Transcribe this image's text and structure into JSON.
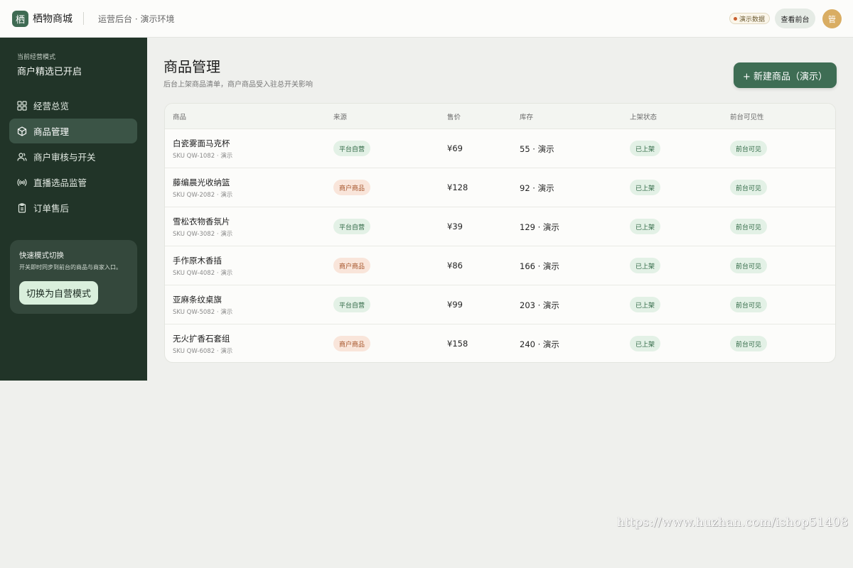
{
  "header": {
    "logo_char": "栖",
    "brand": "栖物商城",
    "env": "运营后台 · 演示环境",
    "demo_badge": "演示数据",
    "frontend_button": "查看前台",
    "avatar_char": "管"
  },
  "sidebar": {
    "mode_caption": "当前经营模式",
    "mode_value": "商户精选已开启",
    "items": [
      {
        "label": "经营总览",
        "icon": "grid-icon",
        "active": false
      },
      {
        "label": "商品管理",
        "icon": "package-icon",
        "active": true
      },
      {
        "label": "商户审核与开关",
        "icon": "users-icon",
        "active": false
      },
      {
        "label": "直播选品监管",
        "icon": "broadcast-icon",
        "active": false
      },
      {
        "label": "订单售后",
        "icon": "clipboard-icon",
        "active": false
      }
    ],
    "switch_card": {
      "title": "快速模式切换",
      "desc": "开关即时同步到前台的商品与商家入口。",
      "button": "切换为自营模式"
    }
  },
  "main": {
    "title": "商品管理",
    "subtitle": "后台上架商品清单，商户商品受入驻总开关影响",
    "new_button": "+ 新建商品（演示）",
    "columns": [
      "商品",
      "来源",
      "售价",
      "库存",
      "上架状态",
      "前台可见性"
    ],
    "rows": [
      {
        "name": "白瓷雾面马克杯",
        "sku": "SKU QW-1082 · 演示",
        "source": "平台自营",
        "source_type": "platform",
        "price": "¥69",
        "stock": "55 · 演示",
        "status": "已上架",
        "visibility": "前台可见"
      },
      {
        "name": "藤编晨光收纳篮",
        "sku": "SKU QW-2082 · 演示",
        "source": "商户商品",
        "source_type": "merchant",
        "price": "¥128",
        "stock": "92 · 演示",
        "status": "已上架",
        "visibility": "前台可见"
      },
      {
        "name": "雪松衣物香氛片",
        "sku": "SKU QW-3082 · 演示",
        "source": "平台自营",
        "source_type": "platform",
        "price": "¥39",
        "stock": "129 · 演示",
        "status": "已上架",
        "visibility": "前台可见"
      },
      {
        "name": "手作原木香插",
        "sku": "SKU QW-4082 · 演示",
        "source": "商户商品",
        "source_type": "merchant",
        "price": "¥86",
        "stock": "166 · 演示",
        "status": "已上架",
        "visibility": "前台可见"
      },
      {
        "name": "亚麻条纹桌旗",
        "sku": "SKU QW-5082 · 演示",
        "source": "平台自营",
        "source_type": "platform",
        "price": "¥99",
        "stock": "203 · 演示",
        "status": "已上架",
        "visibility": "前台可见"
      },
      {
        "name": "无火扩香石套组",
        "sku": "SKU QW-6082 · 演示",
        "source": "商户商品",
        "source_type": "merchant",
        "price": "¥158",
        "stock": "240 · 演示",
        "status": "已上架",
        "visibility": "前台可见"
      }
    ]
  },
  "watermark": "https://www.huzhan.com/ishop51408",
  "colors": {
    "brand": "#3f6b53",
    "sidebar_bg": "#213428",
    "platform_pill": "#e3f1e6",
    "merchant_pill": "#f9e5da"
  }
}
